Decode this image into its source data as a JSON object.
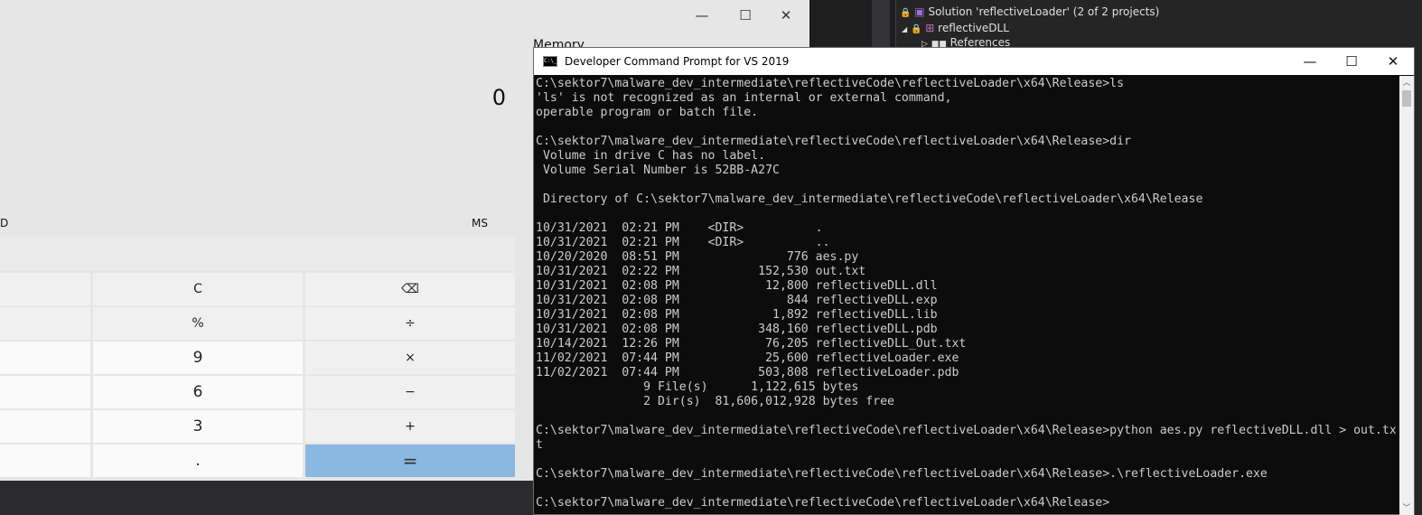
{
  "calculator": {
    "display": "0",
    "memory_label": "Memory",
    "memory_row": {
      "left": "D",
      "right": "MS"
    },
    "controls": {
      "minimize": "—",
      "maximize": "☐",
      "close": "✕"
    },
    "buttons": [
      {
        "label": "C",
        "kind": "op"
      },
      {
        "label": "⌫",
        "kind": "op",
        "icon": "backspace-icon"
      },
      {
        "label": "%",
        "kind": "op"
      },
      {
        "label": "÷",
        "kind": "op"
      },
      {
        "label": "9",
        "kind": "num"
      },
      {
        "label": "×",
        "kind": "op"
      },
      {
        "label": "6",
        "kind": "num"
      },
      {
        "label": "−",
        "kind": "op"
      },
      {
        "label": "3",
        "kind": "num"
      },
      {
        "label": "+",
        "kind": "op"
      },
      {
        "label": ".",
        "kind": "num"
      },
      {
        "label": "=",
        "kind": "eq"
      }
    ],
    "equals_color": "#8ab8e0"
  },
  "solution_explorer": {
    "solution": "Solution 'reflectiveLoader' (2 of 2 projects)",
    "project": "reflectiveDLL",
    "references": "References"
  },
  "terminal": {
    "title": "Developer Command Prompt for VS 2019",
    "icon_text": "C:\\_",
    "controls": {
      "minimize": "—",
      "maximize": "☐",
      "close": "✕"
    },
    "lines": [
      "C:\\sektor7\\malware_dev_intermediate\\reflectiveCode\\reflectiveLoader\\x64\\Release>ls",
      "'ls' is not recognized as an internal or external command,",
      "operable program or batch file.",
      "",
      "C:\\sektor7\\malware_dev_intermediate\\reflectiveCode\\reflectiveLoader\\x64\\Release>dir",
      " Volume in drive C has no label.",
      " Volume Serial Number is 52BB-A27C",
      "",
      " Directory of C:\\sektor7\\malware_dev_intermediate\\reflectiveCode\\reflectiveLoader\\x64\\Release",
      "",
      "10/31/2021  02:21 PM    <DIR>          .",
      "10/31/2021  02:21 PM    <DIR>          ..",
      "10/20/2020  08:51 PM               776 aes.py",
      "10/31/2021  02:22 PM           152,530 out.txt",
      "10/31/2021  02:08 PM            12,800 reflectiveDLL.dll",
      "10/31/2021  02:08 PM               844 reflectiveDLL.exp",
      "10/31/2021  02:08 PM             1,892 reflectiveDLL.lib",
      "10/31/2021  02:08 PM           348,160 reflectiveDLL.pdb",
      "10/14/2021  12:26 PM            76,205 reflectiveDLL_Out.txt",
      "11/02/2021  07:44 PM            25,600 reflectiveLoader.exe",
      "11/02/2021  07:44 PM           503,808 reflectiveLoader.pdb",
      "               9 File(s)      1,122,615 bytes",
      "               2 Dir(s)  81,606,012,928 bytes free",
      "",
      "C:\\sektor7\\malware_dev_intermediate\\reflectiveCode\\reflectiveLoader\\x64\\Release>python aes.py reflectiveDLL.dll > out.tx",
      "t",
      "",
      "C:\\sektor7\\malware_dev_intermediate\\reflectiveCode\\reflectiveLoader\\x64\\Release>.\\reflectiveLoader.exe",
      "",
      "C:\\sektor7\\malware_dev_intermediate\\reflectiveCode\\reflectiveLoader\\x64\\Release>"
    ]
  }
}
